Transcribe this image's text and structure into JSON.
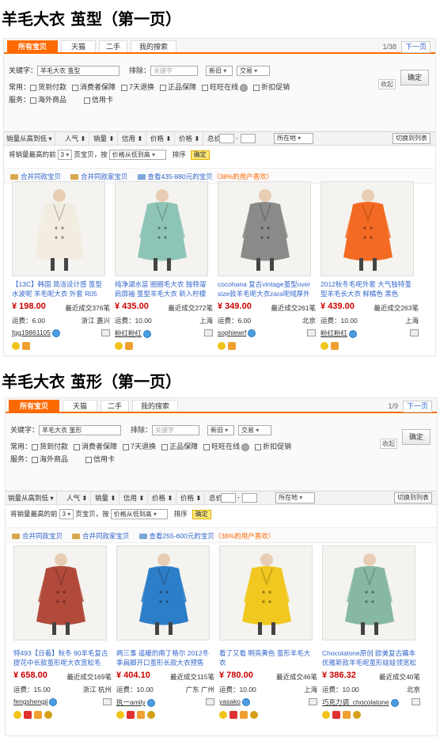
{
  "screens": [
    {
      "heading": "羊毛大衣 茧型（第一页）",
      "tabs": [
        "所有宝贝",
        "天猫",
        "二手",
        "我的搜索"
      ],
      "pager": {
        "count": "1/38",
        "next": "下一页"
      },
      "keyword_label": "关键字：",
      "keyword_value": "羊毛大衣 茧型",
      "exclude_label": "排除：",
      "exclude_placeholder": "关键字",
      "sort_select": "新旧",
      "trade_select": "交易",
      "confirm": "确定",
      "collapse": "收起",
      "common_label": "常用：",
      "options_row1": [
        "货到付款",
        "消费者保障",
        "7天退换",
        "正品保障",
        "旺旺在线",
        "折扣促销"
      ],
      "service_label": "服务：",
      "options_row2": [
        "海外商品",
        "信用卡"
      ],
      "sortbar": {
        "sales": "销量从高到低",
        "popularity": "人气",
        "volume": "销量",
        "credit": "信用",
        "price": "价格",
        "price2": "价格",
        "total": "总价",
        "location": "所在地",
        "list_view": "切换到列表"
      },
      "pagerow": {
        "prefix": "将销量最高的前",
        "num": "3",
        "mid": "页宝贝，按",
        "order": "价格从低到高",
        "sort": "排序",
        "ok": "确定"
      },
      "grouprow": {
        "merge_seller": "合并同款宝贝",
        "merge_same": "合并同款家宝贝",
        "view": "查看435-880元的宝贝",
        "pct": "（38%的用户喜欢）"
      },
      "cards": [
        {
          "title": "【13C】韩国 简洁设计感 茧型 水波呢 羊毛呢大衣 外套 R05",
          "price": "¥ 198.00",
          "sold": "最近成交376笔",
          "ship": "运费：6.00",
          "loc": "浙江 嘉兴",
          "seller": "fgg19861105",
          "coat_color": "#f2ede0"
        },
        {
          "title": "纯净湖水蓝 圈圈毛大衣 独特溜 肩廓袖 茧型羊毛大衣 新入柠檬",
          "price": "¥ 435.00",
          "sold": "最近成交272笔",
          "ship": "运费：10.00",
          "loc": "上海",
          "seller": "粉红粉红",
          "coat_color": "#8ec4b6"
        },
        {
          "title": "cocohana 复古vintage茧型over size款羊毛呢大衣zara呢绒厚外",
          "price": "¥ 349.00",
          "sold": "最近成交261笔",
          "ship": "运费：6.00",
          "loc": "北京",
          "seller": "sophiewrf",
          "coat_color": "#8a8a88"
        },
        {
          "title": "2012秋冬毛呢外套 大气独特茧型羊毛长大衣 鲜橘色 黑色",
          "price": "¥ 439.00",
          "sold": "最近成交263笔",
          "ship": "运费：10.00",
          "loc": "上海",
          "seller": "粉红粉红",
          "coat_color": "#f46a22"
        }
      ]
    },
    {
      "heading": "羊毛大衣 茧形（第一页）",
      "tabs": [
        "所有宝贝",
        "天猫",
        "二手",
        "我的搜索"
      ],
      "pager": {
        "count": "1/9",
        "next": "下一页"
      },
      "keyword_label": "关键字：",
      "keyword_value": "羊毛大衣 茧形",
      "exclude_label": "排除：",
      "exclude_placeholder": "关键字",
      "sort_select": "新旧",
      "trade_select": "交易",
      "confirm": "确定",
      "collapse": "收起",
      "common_label": "常用：",
      "options_row1": [
        "货到付款",
        "消费者保障",
        "7天退换",
        "正品保障",
        "旺旺在线",
        "折扣促销"
      ],
      "service_label": "服务：",
      "options_row2": [
        "海外商品",
        "信用卡"
      ],
      "sortbar": {
        "sales": "销量从高到低",
        "popularity": "人气",
        "volume": "销量",
        "credit": "信用",
        "price": "价格",
        "price2": "价格",
        "total": "总价",
        "location": "所在地",
        "list_view": "切换到列表"
      },
      "pagerow": {
        "prefix": "将销量最高的前",
        "num": "3",
        "mid": "页宝贝，按",
        "order": "价格从低到高",
        "sort": "排序",
        "ok": "确定"
      },
      "grouprow": {
        "merge_seller": "合并同款宝贝",
        "merge_same": "合并同款家宝贝",
        "view": "查看255-600元的宝贝",
        "pct": "（38%的用户喜欢）"
      },
      "cards": [
        {
          "title": "特493【日着】秋冬 90羊毛复古提花中长款茧形呢大衣宽松毛",
          "price": "¥ 658.00",
          "sold": "最近成交169笔",
          "ship": "运费：15.00",
          "loc": "浙江 杭州",
          "seller": "fengshengji",
          "coat_color": "#b24a3c"
        },
        {
          "title": "两三事 遥暖的南丁格尔 2012冬季扁脚开口茧形长款大衣预售",
          "price": "¥ 404.10",
          "sold": "最近成交115笔",
          "ship": "运费：10.00",
          "loc": "广东 广州",
          "seller": "执一amily",
          "coat_color": "#2d7ec8"
        },
        {
          "title": "看了又看 明亮黄色 茧形羊毛大衣",
          "price": "¥ 780.00",
          "sold": "最近成交46笔",
          "ship": "运费：10.00",
          "loc": "上海",
          "seller": "yasako",
          "coat_color": "#f0c820"
        },
        {
          "title": "Chocolatone原创 欧美复古藕本优雅新款羊毛呢茧形娃娃领宽松",
          "price": "¥ 386.32",
          "sold": "最近成交40笔",
          "ship": "运费：10.00",
          "loc": "北京",
          "seller": "巧克力调_chocolatone",
          "coat_color": "#86b8a2"
        }
      ]
    }
  ]
}
